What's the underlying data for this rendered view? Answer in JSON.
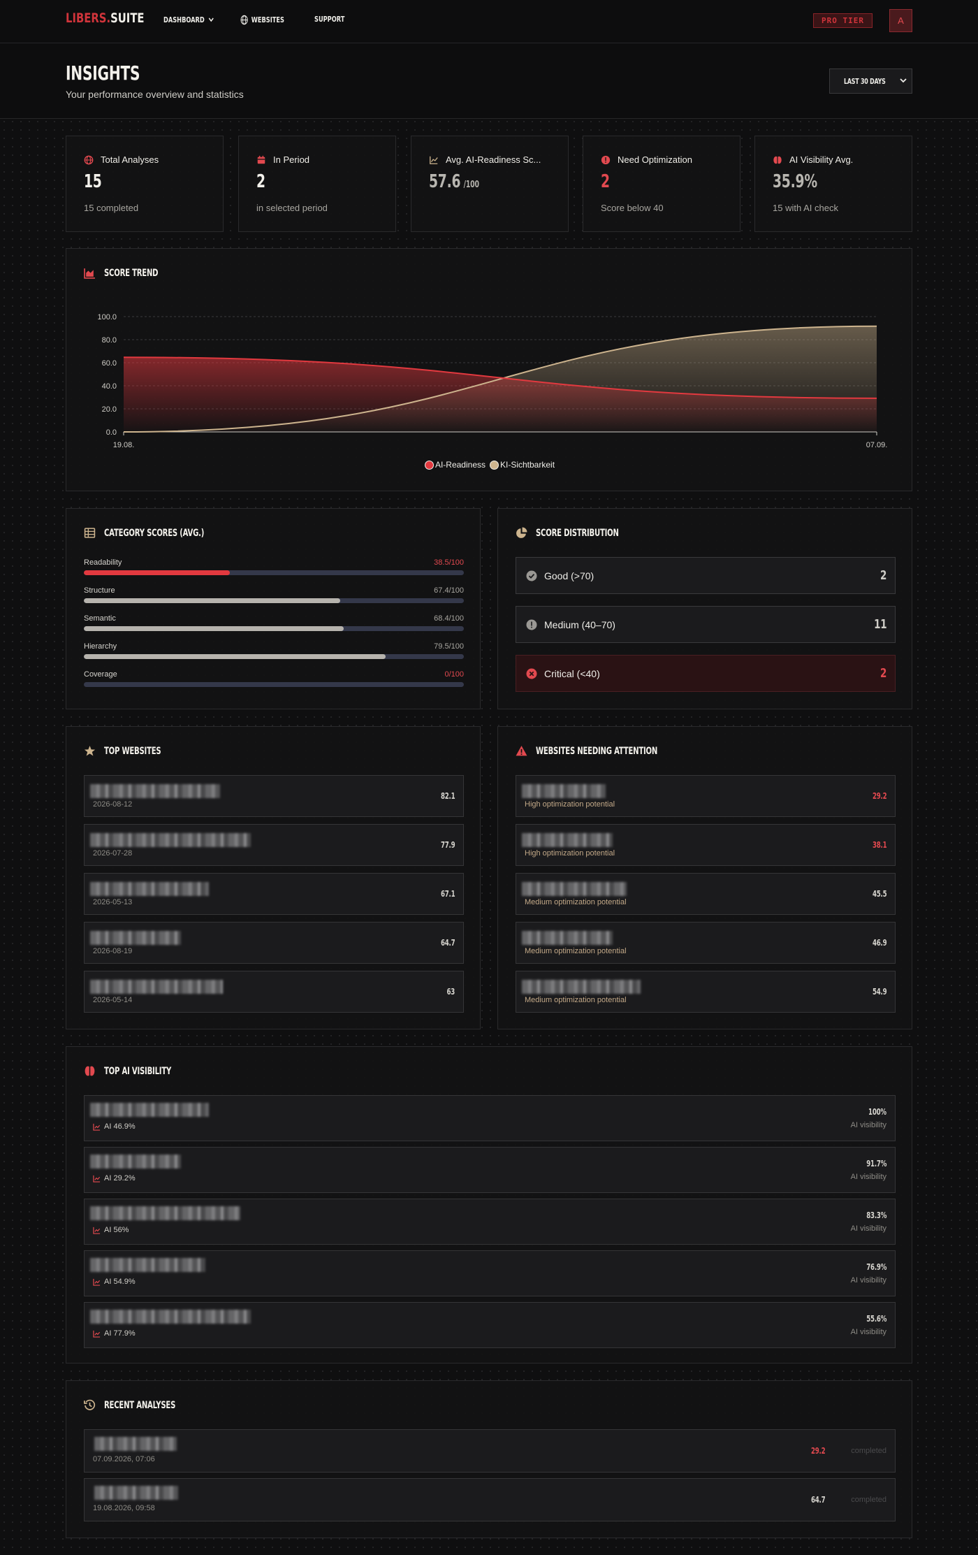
{
  "nav": {
    "logo_left": "LIBERS",
    "logo_dot": ".",
    "logo_right": "SUITE",
    "dashboard": "DASHBOARD",
    "websites": "WEBSITES",
    "support": "SUPPORT",
    "badge": "PRO TIER",
    "avatar_initial": "A"
  },
  "header": {
    "title": "INSIGHTS",
    "subtitle": "Your performance overview and statistics",
    "range": "LAST 30 DAYS"
  },
  "stats": [
    {
      "label": "Total Analyses",
      "value": "15",
      "suffix": "",
      "note": "15 completed",
      "icon": "globe-icon",
      "color": "#f3f1eb"
    },
    {
      "label": "In Period",
      "value": "2",
      "suffix": "",
      "note": "in selected period",
      "icon": "calendar-icon",
      "color": "#f3f1eb"
    },
    {
      "label": "Avg. AI-Readiness Sc...",
      "value": "57.6",
      "suffix": "/100",
      "note": "",
      "icon": "chart-line-icon",
      "color": "#b8b6b0"
    },
    {
      "label": "Need Optimization",
      "value": "2",
      "suffix": "",
      "note": "Score below 40",
      "icon": "alert-icon",
      "color": "#e2494f"
    },
    {
      "label": "AI Visibility Avg.",
      "value": "35.9%",
      "suffix": "",
      "note": "15 with AI check",
      "icon": "brain-icon",
      "color": "#b8b6b0"
    }
  ],
  "score_trend": {
    "title": "SCORE TREND",
    "legend": [
      "AI-Readiness",
      "KI-Sichtbarkeit"
    ]
  },
  "chart_data": {
    "type": "area",
    "x": [
      "19.08.",
      "07.09."
    ],
    "ytick_labels": [
      "0.0",
      "20.0",
      "40.0",
      "60.0",
      "80.0",
      "100.0"
    ],
    "ylim": [
      0,
      100
    ],
    "series": [
      {
        "name": "AI-Readiness",
        "color": "#e2393f",
        "values": [
          64.7,
          29.2
        ]
      },
      {
        "name": "KI-Sichtbarkeit",
        "color": "#cdb48e",
        "values": [
          0,
          91.7
        ]
      }
    ],
    "grid": true,
    "legend_position": "bottom-center"
  },
  "category_scores": {
    "title": "CATEGORY SCORES (AVG.)",
    "items": [
      {
        "name": "Readability",
        "value": "38.5/100",
        "score": 38.5,
        "highlight": true
      },
      {
        "name": "Structure",
        "value": "67.4/100",
        "score": 67.4,
        "highlight": false
      },
      {
        "name": "Semantic",
        "value": "68.4/100",
        "score": 68.4,
        "highlight": false
      },
      {
        "name": "Hierarchy",
        "value": "79.5/100",
        "score": 79.5,
        "highlight": false
      },
      {
        "name": "Coverage",
        "value": "0/100",
        "score": 0,
        "highlight": true
      }
    ]
  },
  "score_distribution": {
    "title": "SCORE DISTRIBUTION",
    "items": [
      {
        "label": "Good (>70)",
        "count": "2",
        "kind": "good"
      },
      {
        "label": "Medium (40–70)",
        "count": "11",
        "kind": "medium"
      },
      {
        "label": "Critical (<40)",
        "count": "2",
        "kind": "critical"
      }
    ]
  },
  "top_websites": {
    "title": "TOP WEBSITES",
    "items": [
      {
        "date": "2026-08-12",
        "score": "82.1"
      },
      {
        "date": "2026-07-28",
        "score": "77.9"
      },
      {
        "date": "2026-05-13",
        "score": "67.1"
      },
      {
        "date": "2026-08-19",
        "score": "64.7"
      },
      {
        "date": "2026-05-14",
        "score": "63"
      }
    ]
  },
  "attention_websites": {
    "title": "WEBSITES NEEDING ATTENTION",
    "items": [
      {
        "note": "High optimization potential",
        "score": "29.2",
        "red": true
      },
      {
        "note": "High optimization potential",
        "score": "38.1",
        "red": true
      },
      {
        "note": "Medium optimization potential",
        "score": "45.5",
        "red": false
      },
      {
        "note": "Medium optimization potential",
        "score": "46.9",
        "red": false
      },
      {
        "note": "Medium optimization potential",
        "score": "54.9",
        "red": false
      }
    ]
  },
  "ai_visibility": {
    "title": "TOP AI VISIBILITY",
    "visibility_label": "AI visibility",
    "items": [
      {
        "ai": "AI 46.9%",
        "pct": "100%"
      },
      {
        "ai": "AI 29.2%",
        "pct": "91.7%"
      },
      {
        "ai": "AI 56%",
        "pct": "83.3%"
      },
      {
        "ai": "AI 54.9%",
        "pct": "76.9%"
      },
      {
        "ai": "AI 77.9%",
        "pct": "55.6%"
      }
    ]
  },
  "recent_analyses": {
    "title": "RECENT ANALYSES",
    "items": [
      {
        "datetime": "07.09.2026, 07:06",
        "score": "29.2",
        "status": "completed",
        "red": true
      },
      {
        "datetime": "19.08.2026, 09:58",
        "score": "64.7",
        "status": "completed",
        "red": false
      }
    ]
  },
  "colors": {
    "accent": "#d1343b",
    "gold": "#cdb48e",
    "background": "#0f0f10"
  }
}
